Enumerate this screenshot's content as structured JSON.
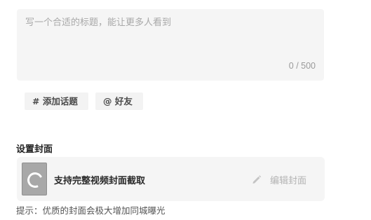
{
  "title_input": {
    "placeholder": "写一个合适的标题，能让更多人看到",
    "value": "",
    "counter": "0 / 500"
  },
  "chips": {
    "topic_label": "# 添加话题",
    "friend_label": "@ 好友"
  },
  "cover": {
    "section_title": "设置封面",
    "label": "支持完整视频封面截取",
    "edit_label": "编辑封面",
    "tip": "提示：优质的封面会极大增加同城曝光"
  },
  "icons": {
    "thumbnail": "loading-spinner-icon",
    "edit": "pencil-icon"
  },
  "colors": {
    "panel_bg": "#f5f5f5",
    "chip_bg": "#f3f3f3",
    "muted_text": "#b3b3b3"
  }
}
